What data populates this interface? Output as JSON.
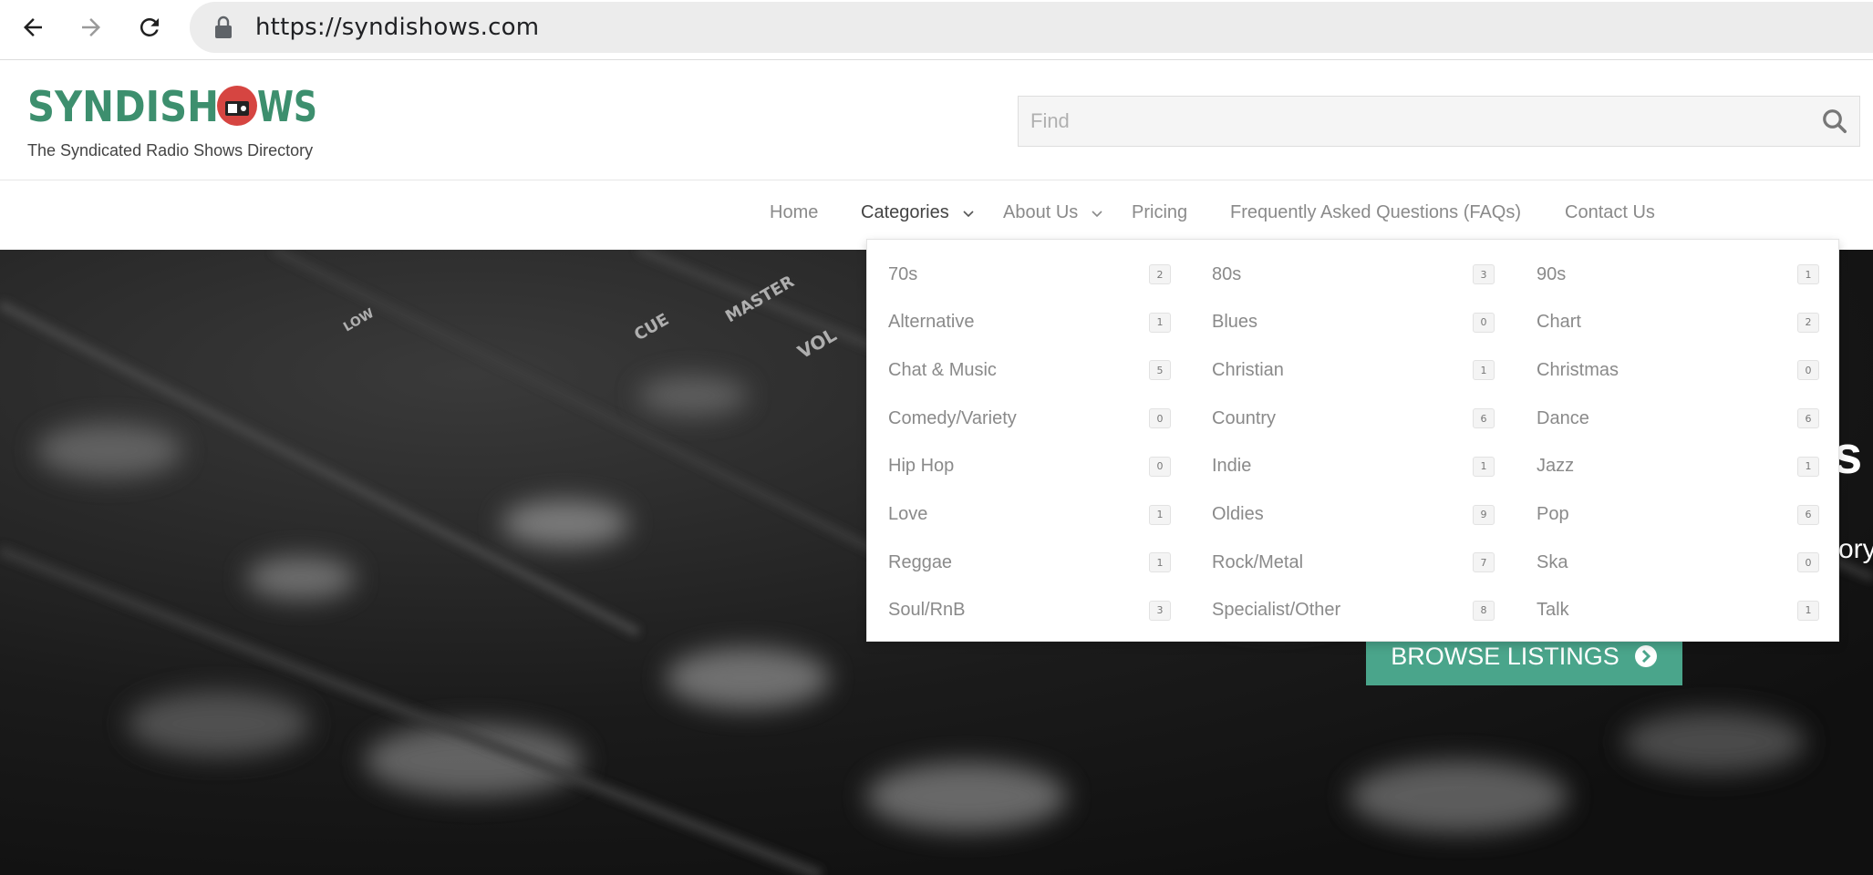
{
  "browser": {
    "url": "https://syndishows.com"
  },
  "header": {
    "logo_text": "SYNDISHOWS",
    "tagline": "The Syndicated Radio Shows Directory",
    "search_placeholder": "Find"
  },
  "nav": {
    "items": [
      {
        "label": "Home"
      },
      {
        "label": "Categories"
      },
      {
        "label": "About Us"
      },
      {
        "label": "Pricing"
      },
      {
        "label": "Frequently Asked Questions (FAQs)"
      },
      {
        "label": "Contact Us"
      }
    ]
  },
  "categories": [
    {
      "label": "70s",
      "count": "2"
    },
    {
      "label": "80s",
      "count": "3"
    },
    {
      "label": "90s",
      "count": "1"
    },
    {
      "label": "Alternative",
      "count": "1"
    },
    {
      "label": "Blues",
      "count": "0"
    },
    {
      "label": "Chart",
      "count": "2"
    },
    {
      "label": "Chat & Music",
      "count": "5"
    },
    {
      "label": "Christian",
      "count": "1"
    },
    {
      "label": "Christmas",
      "count": "0"
    },
    {
      "label": "Comedy/Variety",
      "count": "0"
    },
    {
      "label": "Country",
      "count": "6"
    },
    {
      "label": "Dance",
      "count": "6"
    },
    {
      "label": "Hip Hop",
      "count": "0"
    },
    {
      "label": "Indie",
      "count": "1"
    },
    {
      "label": "Jazz",
      "count": "1"
    },
    {
      "label": "Love",
      "count": "1"
    },
    {
      "label": "Oldies",
      "count": "9"
    },
    {
      "label": "Pop",
      "count": "6"
    },
    {
      "label": "Reggae",
      "count": "1"
    },
    {
      "label": "Rock/Metal",
      "count": "7"
    },
    {
      "label": "Ska",
      "count": "0"
    },
    {
      "label": "Soul/RnB",
      "count": "3"
    },
    {
      "label": "Specialist/Other",
      "count": "8"
    },
    {
      "label": "Talk",
      "count": "1"
    }
  ],
  "hero": {
    "title_fragment": "s",
    "subtitle_fragment": "ory",
    "button_label": "BROWSE LISTINGS"
  },
  "colors": {
    "brand_green": "#3d8f6e",
    "brand_red": "#d64541",
    "button_green": "#4aa58b"
  }
}
